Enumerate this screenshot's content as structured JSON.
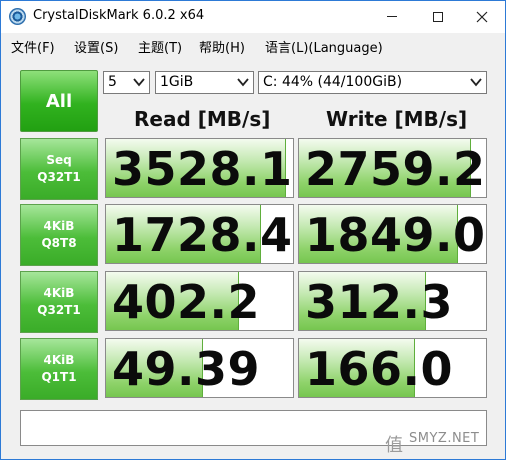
{
  "window": {
    "title": "CrystalDiskMark 6.0.2 x64"
  },
  "menu": {
    "items": [
      "文件(F)",
      "设置(S)",
      "主题(T)",
      "帮助(H)",
      "语言(L)(Language)"
    ]
  },
  "controls": {
    "all_label": "All",
    "count": "5",
    "size": "1GiB",
    "drive": "C: 44% (44/100GiB)"
  },
  "headers": {
    "read": "Read [MB/s]",
    "write": "Write [MB/s]"
  },
  "tests": [
    {
      "line1": "Seq",
      "line2": "Q32T1",
      "read": "3528.1",
      "write": "2759.2",
      "read_fill": 0.96,
      "write_fill": 0.92
    },
    {
      "line1": "4KiB",
      "line2": "Q8T8",
      "read": "1728.4",
      "write": "1849.0",
      "read_fill": 0.83,
      "write_fill": 0.85
    },
    {
      "line1": "4KiB",
      "line2": "Q32T1",
      "read": "402.2",
      "write": "312.3",
      "read_fill": 0.71,
      "write_fill": 0.68
    },
    {
      "line1": "4KiB",
      "line2": "Q1T1",
      "read": "49.39",
      "write": "166.0",
      "read_fill": 0.52,
      "write_fill": 0.62
    }
  ],
  "comment": "",
  "watermark": {
    "glyph": "值",
    "text": "SMYZ.NET"
  }
}
